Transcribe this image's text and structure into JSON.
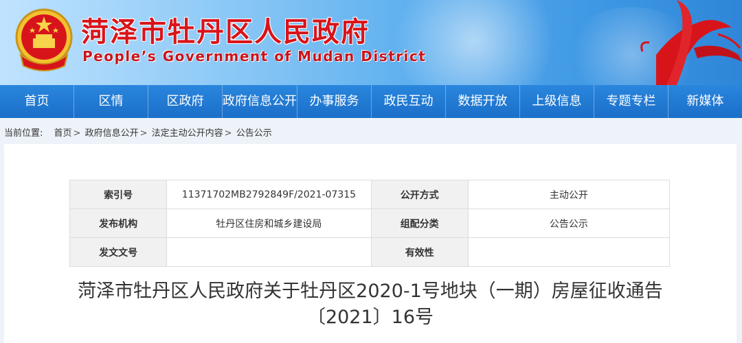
{
  "header": {
    "title_cn": "菏泽市牡丹区人民政府",
    "title_en": "People’s Government of Mudan District"
  },
  "nav": [
    "首页",
    "区情",
    "区政府",
    "政府信息公开",
    "办事服务",
    "政民互动",
    "数据开放",
    "上级信息",
    "专题专栏",
    "新媒体"
  ],
  "breadcrumb": {
    "label": "当前位置:",
    "items": [
      "首页",
      "政府信息公开",
      "法定主动公开内容",
      "公告公示"
    ],
    "separator": ">"
  },
  "meta_table": {
    "rows": [
      {
        "k1": "索引号",
        "v1": "11371702MB2792849F/2021-07315",
        "k2": "公开方式",
        "v2": "主动公开"
      },
      {
        "k1": "发布机构",
        "v1": "牡丹区住房和城乡建设局",
        "k2": "组配分类",
        "v2": "公告公示"
      },
      {
        "k1": "发文文号",
        "v1": "",
        "k2": "有效性",
        "v2": ""
      }
    ]
  },
  "document": {
    "title_line1": "菏泽市牡丹区人民政府关于牡丹区2020-1号地块（一期）房屋征收通告",
    "title_line2": "〔2021〕16号"
  },
  "colors": {
    "nav_bg": "#1b6fc9",
    "title_red": "#d8141b",
    "page_bg": "#eef3f9"
  }
}
